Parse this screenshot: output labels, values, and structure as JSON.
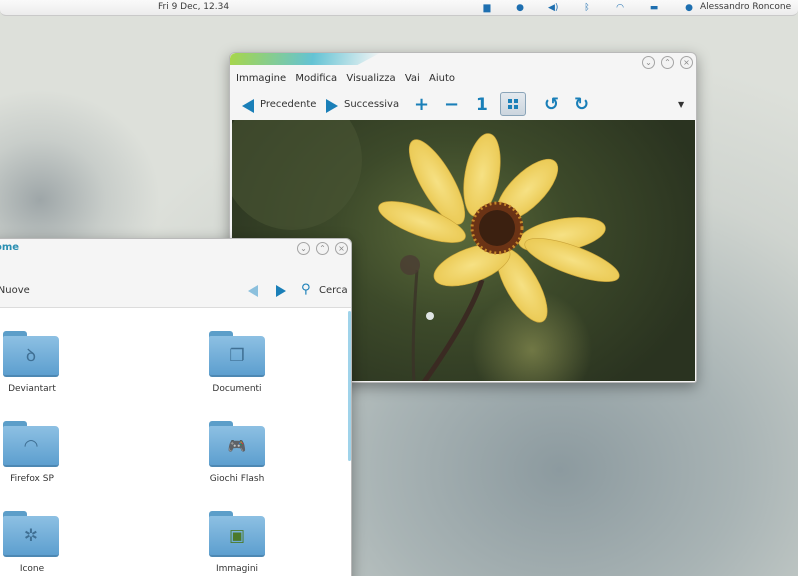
{
  "top_panel": {
    "clock": "Fri  9 Dec, 12.34",
    "user": "Alessandro Roncone",
    "tray_icons": [
      "folder-icon",
      "bluetooth-circle-icon",
      "volume-icon",
      "bluetooth-icon",
      "wifi-icon",
      "battery-icon",
      "chat-icon"
    ]
  },
  "viewer": {
    "menu": [
      "Immagine",
      "Modifica",
      "Visualizza",
      "Vai",
      "Aiuto"
    ],
    "toolbar": {
      "prev_label": "Precedente",
      "next_label": "Successiva",
      "zoom_in": "+",
      "zoom_out": "−",
      "zoom_1": "1",
      "rotate_left": "↺",
      "rotate_right": "↻",
      "menu_arrow": "▼"
    }
  },
  "files": {
    "title": "ome",
    "path_label": "iNuove",
    "search_label": "Cerca",
    "folders": [
      {
        "label": "Deviantart",
        "icon": "deviantart-icon",
        "glyph": "ꝺ"
      },
      {
        "label": "Documenti",
        "icon": "documents-icon",
        "glyph": "❐"
      },
      {
        "label": "Firefox SP",
        "icon": "wifi-icon",
        "glyph": "◠"
      },
      {
        "label": "Giochi Flash",
        "icon": "gamepad-icon",
        "glyph": "🎮"
      },
      {
        "label": "Icone",
        "icon": "icons-icon",
        "glyph": "✲"
      },
      {
        "label": "Immagini",
        "icon": "images-icon",
        "glyph": "▣"
      }
    ]
  },
  "colors": {
    "accent": "#1a7fb8",
    "folder": "#6ea9d4",
    "title_accent": "#2a8fb2"
  }
}
